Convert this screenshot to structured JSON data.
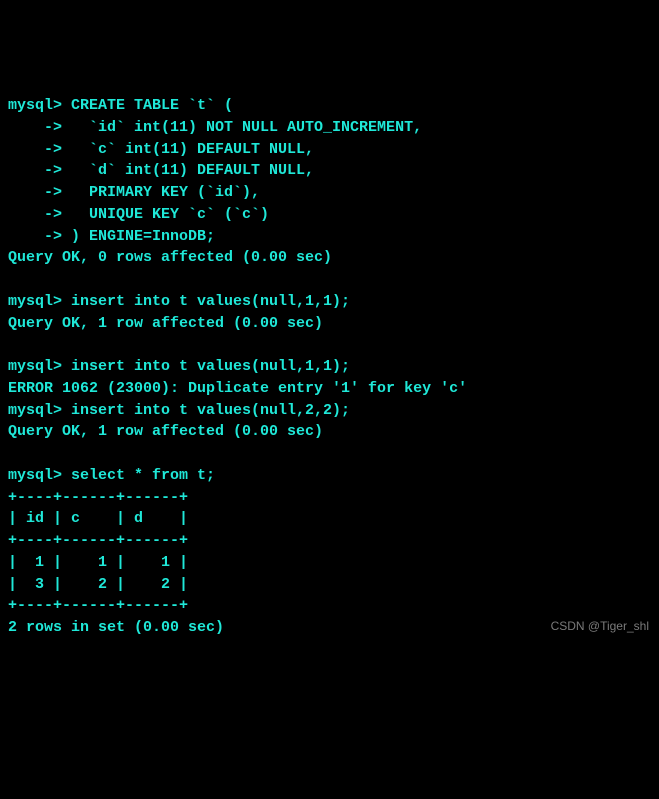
{
  "terminal": {
    "lines": [
      "mysql> CREATE TABLE `t` (",
      "    ->   `id` int(11) NOT NULL AUTO_INCREMENT,",
      "    ->   `c` int(11) DEFAULT NULL,",
      "    ->   `d` int(11) DEFAULT NULL,",
      "    ->   PRIMARY KEY (`id`),",
      "    ->   UNIQUE KEY `c` (`c`)",
      "    -> ) ENGINE=InnoDB;",
      "Query OK, 0 rows affected (0.00 sec)",
      "",
      "mysql> insert into t values(null,1,1);",
      "Query OK, 1 row affected (0.00 sec)",
      "",
      "mysql> insert into t values(null,1,1);",
      "ERROR 1062 (23000): Duplicate entry '1' for key 'c'",
      "mysql> insert into t values(null,2,2);",
      "Query OK, 1 row affected (0.00 sec)",
      "",
      "mysql> select * from t;",
      "+----+------+------+",
      "| id | c    | d    |",
      "+----+------+------+",
      "|  1 |    1 |    1 |",
      "|  3 |    2 |    2 |",
      "+----+------+------+",
      "2 rows in set (0.00 sec)"
    ]
  },
  "watermark": "CSDN @Tiger_shl"
}
